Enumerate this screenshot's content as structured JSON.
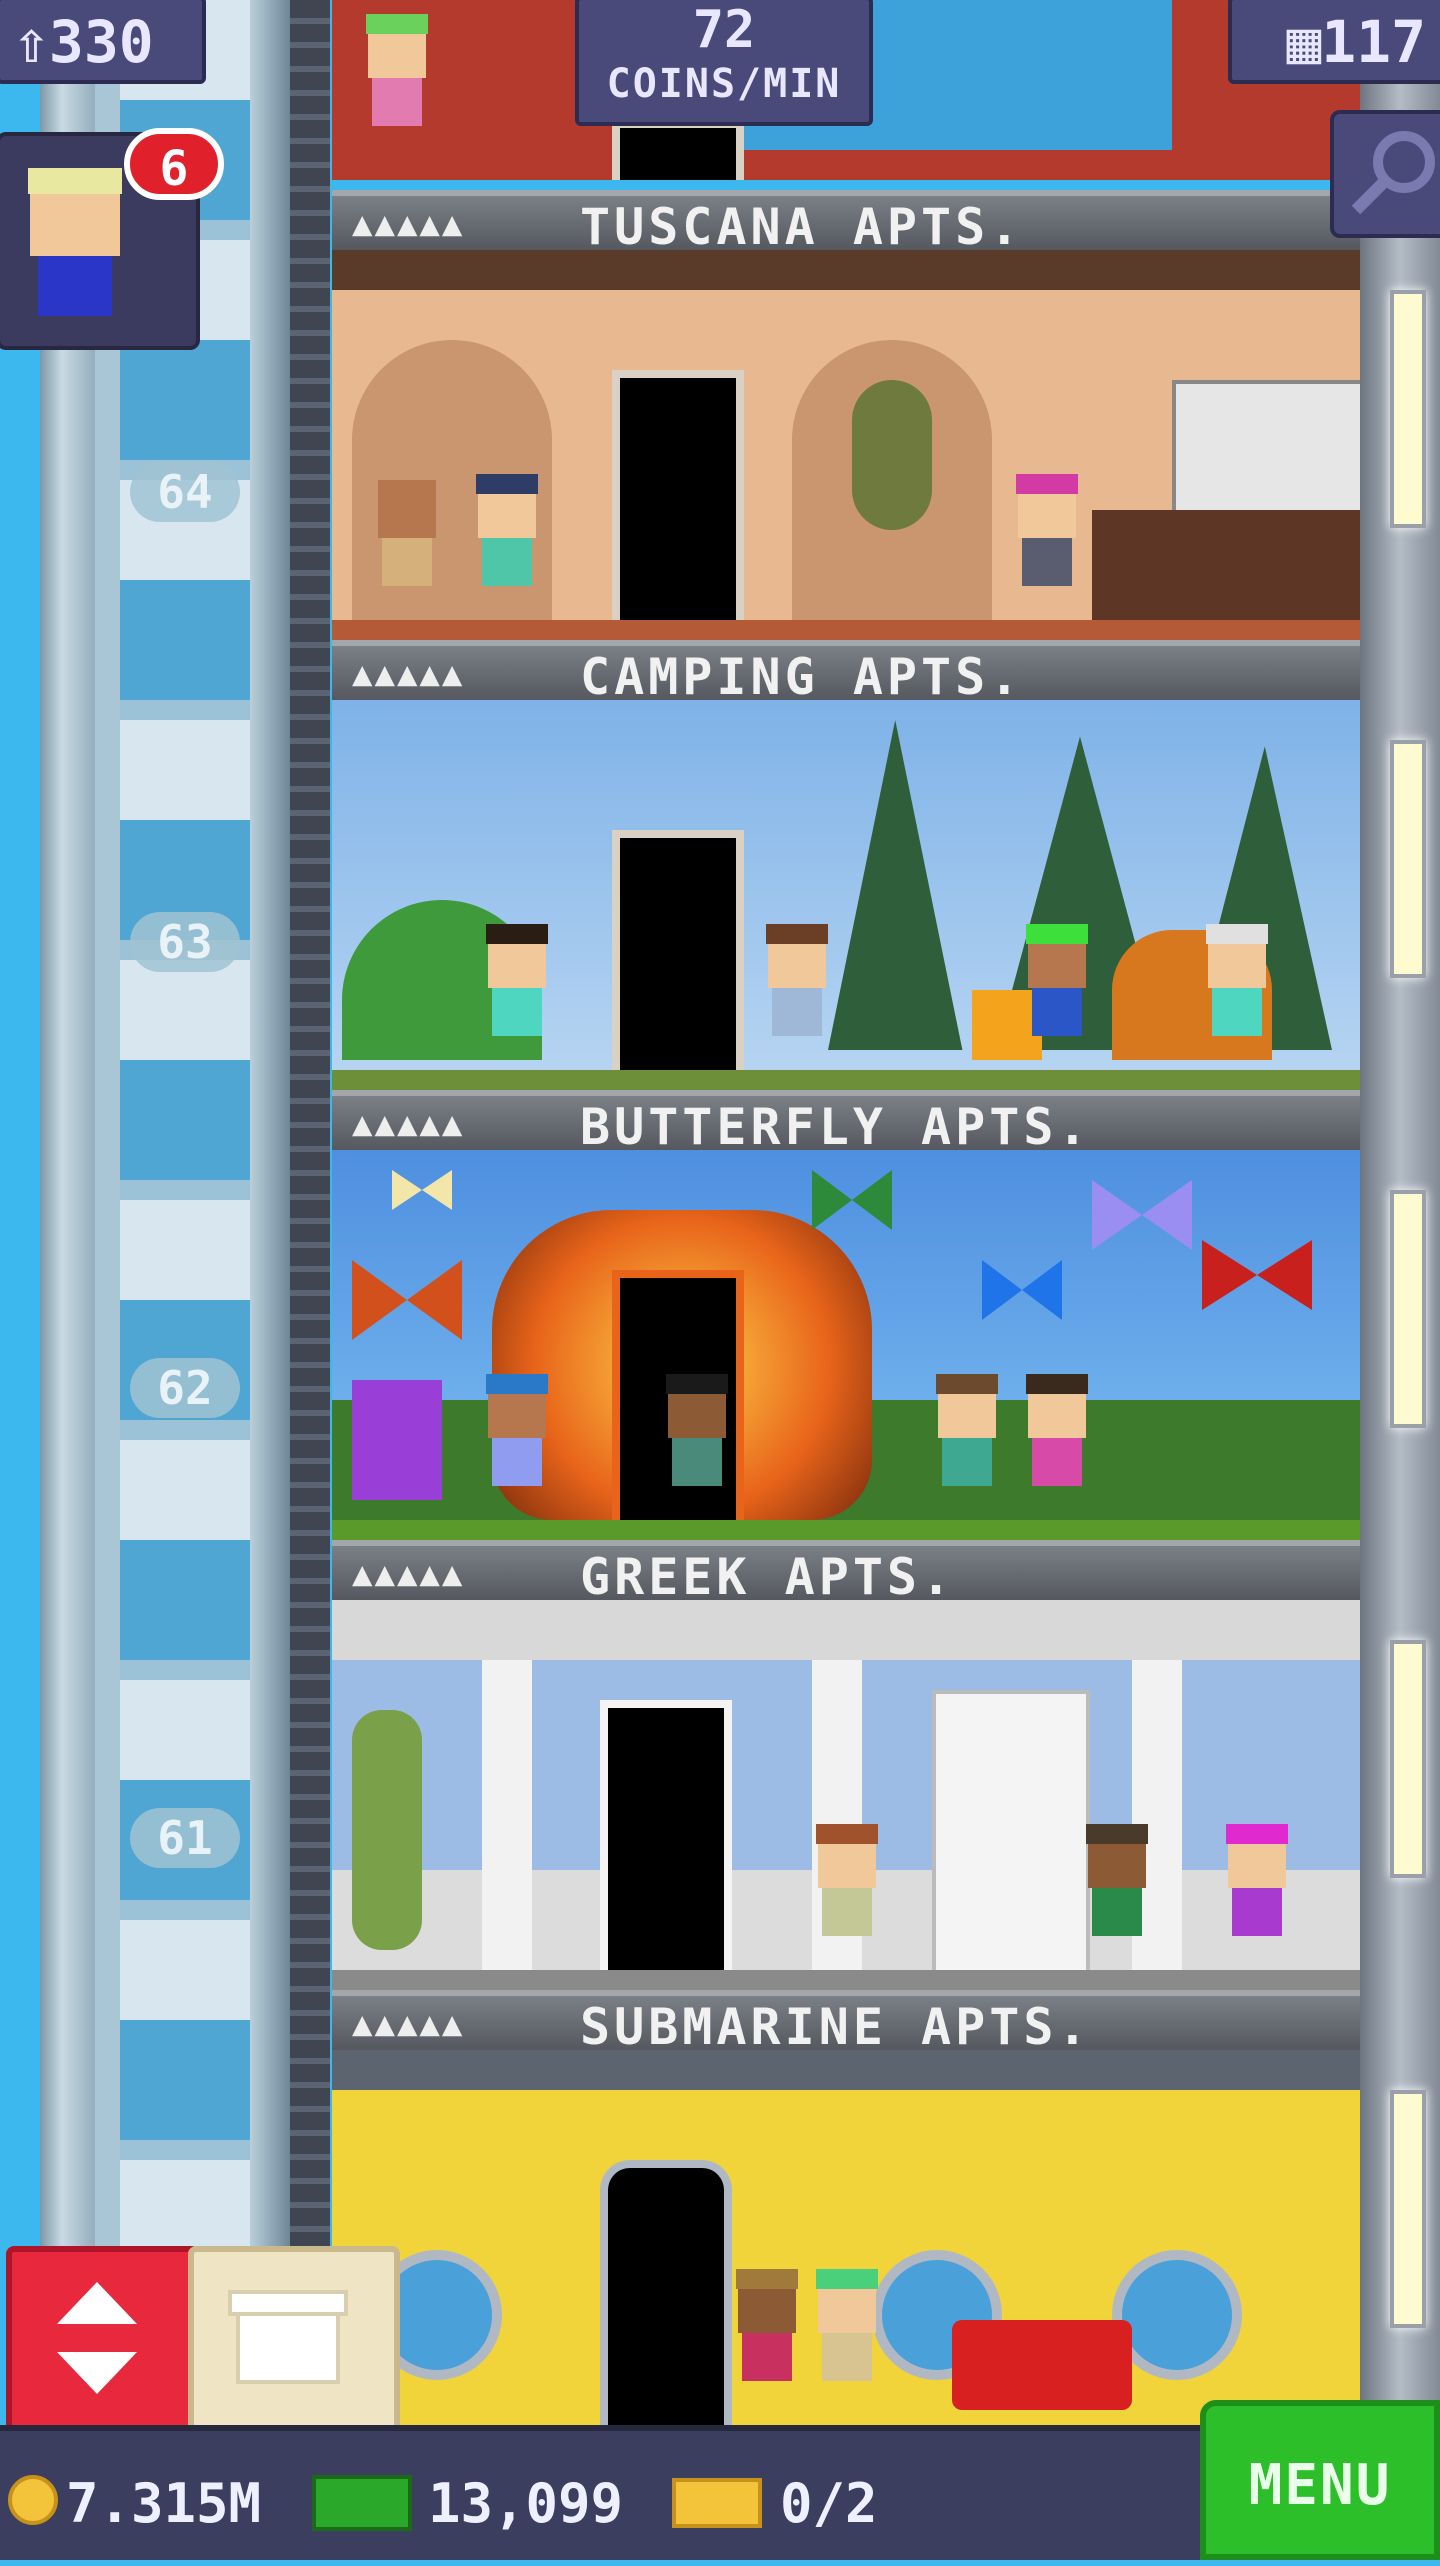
{
  "hud": {
    "residents": "330",
    "coins_per_min_value": "72",
    "coins_per_min_label": "COINS/MIN",
    "floors": "117",
    "visitor_badge": "6"
  },
  "floors": [
    {
      "number": "64",
      "label": "TUSCANA APTS.",
      "occupancy": "▲▲▲▲▲"
    },
    {
      "number": "63",
      "label": "CAMPING APTS.",
      "occupancy": "▲▲▲▲▲"
    },
    {
      "number": "62",
      "label": "BUTTERFLY APTS.",
      "occupancy": "▲▲▲▲▲"
    },
    {
      "number": "61",
      "label": "GREEK APTS.",
      "occupancy": "▲▲▲▲▲"
    },
    {
      "number": "",
      "label": "SUBMARINE APTS.",
      "occupancy": "▲▲▲▲▲"
    }
  ],
  "bottom": {
    "coins": "7.315M",
    "bux": "13,099",
    "tickets": "0/2",
    "menu_label": "MENU"
  },
  "colors": {
    "hud_bg": "#4a4a7a",
    "menu_green": "#2dbf2a",
    "elevator_red": "#e8283c",
    "sky": "#3cb8ee"
  }
}
